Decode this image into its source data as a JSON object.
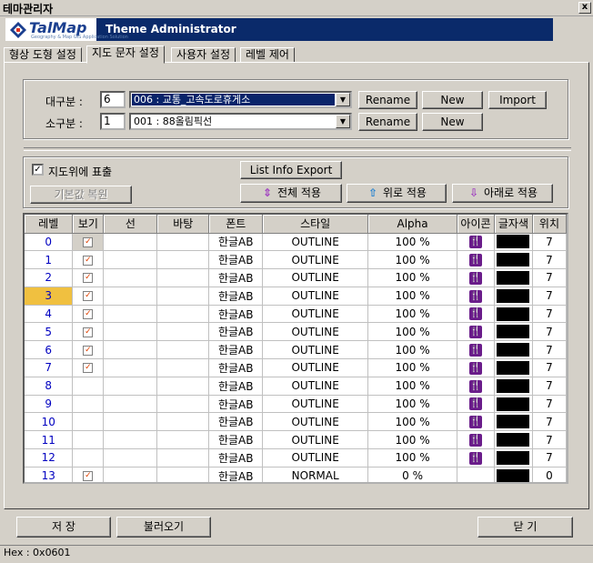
{
  "window": {
    "title": "테마관리자",
    "close_label": "x"
  },
  "banner": {
    "logo_text": "TalMap",
    "logo_sub": "Geography & Map GIS Application Solution",
    "title": "Theme Administrator"
  },
  "tabs": [
    {
      "label": "형상 도형 설정",
      "active": false
    },
    {
      "label": "지도 문자 설정",
      "active": true
    },
    {
      "label": "사용자 설정",
      "active": false
    },
    {
      "label": "레벨 제어",
      "active": false
    }
  ],
  "category": {
    "major_label": "대구분 :",
    "major_value": "6",
    "major_selected": "006 : 교통_고속도로휴게소",
    "minor_label": "소구분 :",
    "minor_value": "1",
    "minor_selected": "001 : 88올림픽선",
    "rename_label": "Rename",
    "new_label": "New",
    "import_label": "Import"
  },
  "options": {
    "show_on_map_label": "지도위에 표출",
    "show_on_map_checked": true,
    "reset_default_label": "기본값 복원",
    "list_info_export_label": "List Info Export",
    "apply_all_label": "전체 적용",
    "apply_up_label": "위로 적용",
    "apply_down_label": "아래로 적용"
  },
  "grid": {
    "headers": [
      "레벨",
      "보기",
      "선",
      "바탕",
      "폰트",
      "스타일",
      "Alpha",
      "아이콘",
      "글자색",
      "위치"
    ],
    "selected_level": "3",
    "rows": [
      {
        "level": "0",
        "view": true,
        "font": "한글AB",
        "style": "OUTLINE",
        "alpha": "100 %",
        "icon": true,
        "color": "#000000",
        "pos": "7"
      },
      {
        "level": "1",
        "view": true,
        "font": "한글AB",
        "style": "OUTLINE",
        "alpha": "100 %",
        "icon": true,
        "color": "#000000",
        "pos": "7"
      },
      {
        "level": "2",
        "view": true,
        "font": "한글AB",
        "style": "OUTLINE",
        "alpha": "100 %",
        "icon": true,
        "color": "#000000",
        "pos": "7"
      },
      {
        "level": "3",
        "view": true,
        "font": "한글AB",
        "style": "OUTLINE",
        "alpha": "100 %",
        "icon": true,
        "color": "#000000",
        "pos": "7"
      },
      {
        "level": "4",
        "view": true,
        "font": "한글AB",
        "style": "OUTLINE",
        "alpha": "100 %",
        "icon": true,
        "color": "#000000",
        "pos": "7"
      },
      {
        "level": "5",
        "view": true,
        "font": "한글AB",
        "style": "OUTLINE",
        "alpha": "100 %",
        "icon": true,
        "color": "#000000",
        "pos": "7"
      },
      {
        "level": "6",
        "view": true,
        "font": "한글AB",
        "style": "OUTLINE",
        "alpha": "100 %",
        "icon": true,
        "color": "#000000",
        "pos": "7"
      },
      {
        "level": "7",
        "view": true,
        "font": "한글AB",
        "style": "OUTLINE",
        "alpha": "100 %",
        "icon": true,
        "color": "#000000",
        "pos": "7"
      },
      {
        "level": "8",
        "view": false,
        "font": "한글AB",
        "style": "OUTLINE",
        "alpha": "100 %",
        "icon": true,
        "color": "#000000",
        "pos": "7"
      },
      {
        "level": "9",
        "view": false,
        "font": "한글AB",
        "style": "OUTLINE",
        "alpha": "100 %",
        "icon": true,
        "color": "#000000",
        "pos": "7"
      },
      {
        "level": "10",
        "view": false,
        "font": "한글AB",
        "style": "OUTLINE",
        "alpha": "100 %",
        "icon": true,
        "color": "#000000",
        "pos": "7"
      },
      {
        "level": "11",
        "view": false,
        "font": "한글AB",
        "style": "OUTLINE",
        "alpha": "100 %",
        "icon": true,
        "color": "#000000",
        "pos": "7"
      },
      {
        "level": "12",
        "view": false,
        "font": "한글AB",
        "style": "OUTLINE",
        "alpha": "100 %",
        "icon": true,
        "color": "#000000",
        "pos": "7"
      },
      {
        "level": "13",
        "view": true,
        "font": "한글AB",
        "style": "NORMAL",
        "alpha": "0 %",
        "icon": false,
        "color": "#000000",
        "pos": "0"
      }
    ]
  },
  "footer": {
    "save_label": "저 장",
    "load_label": "불러오기",
    "close_label": "닫 기"
  },
  "status": {
    "text": "Hex : 0x0601"
  }
}
